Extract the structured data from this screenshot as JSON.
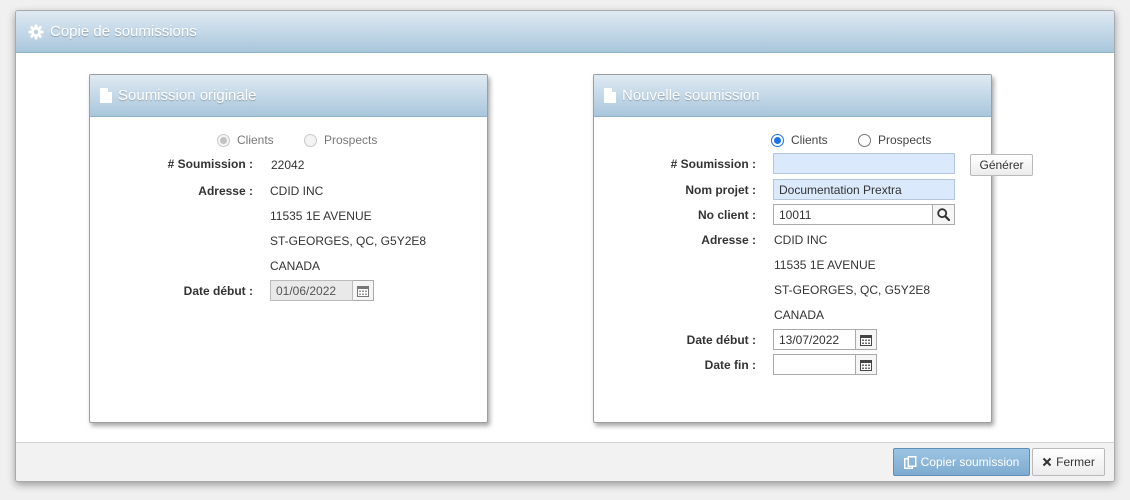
{
  "dialog": {
    "title": "Copie de soumissions",
    "icon": "gear-icon",
    "colors": {
      "header_start": "#dfeaf3",
      "header_end": "#a9c6dc",
      "primary_button": "#8bb6d9"
    }
  },
  "original": {
    "title": "Soumission originale",
    "icon": "document-icon",
    "radio_clients": "Clients",
    "radio_prospects": "Prospects",
    "selected": "Clients",
    "soumission_label": "# Soumission :",
    "soumission_value": "22042",
    "adresse_label": "Adresse :",
    "address": [
      "CDID INC",
      "11535 1E AVENUE",
      "ST-GEORGES, QC, G5Y2E8",
      "CANADA"
    ],
    "date_debut_label": "Date début :",
    "date_debut_value": "01/06/2022"
  },
  "new": {
    "title": "Nouvelle soumission",
    "icon": "document-icon",
    "radio_clients": "Clients",
    "radio_prospects": "Prospects",
    "selected": "Clients",
    "soumission_label": "# Soumission :",
    "soumission_value": "",
    "generer_label": "Générer",
    "nom_projet_label": "Nom projet :",
    "nom_projet_value": "Documentation Prextra",
    "no_client_label": "No client :",
    "no_client_value": "10011",
    "adresse_label": "Adresse :",
    "address": [
      "CDID INC",
      "11535 1E AVENUE",
      "ST-GEORGES, QC, G5Y2E8",
      "CANADA"
    ],
    "date_debut_label": "Date début :",
    "date_debut_value": "13/07/2022",
    "date_fin_label": "Date fin :",
    "date_fin_value": ""
  },
  "footer": {
    "copier_label": "Copier soumission",
    "fermer_label": "Fermer"
  }
}
